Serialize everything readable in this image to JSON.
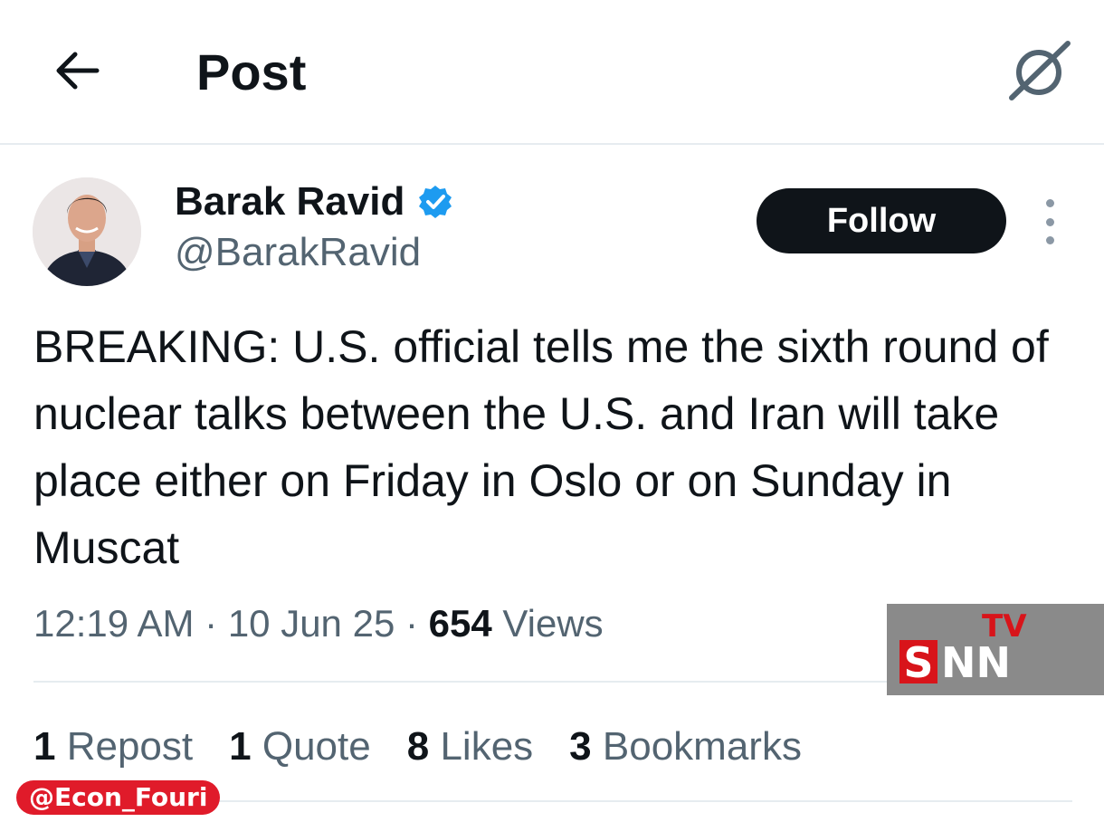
{
  "header": {
    "title": "Post",
    "back_icon": "arrow-left-icon",
    "grok_icon": "grok-icon"
  },
  "author": {
    "display_name": "Barak Ravid",
    "handle": "@BarakRavid",
    "verified_icon": "verified-badge-icon",
    "verified_color": "#1d9bf0"
  },
  "follow_button": {
    "label": "Follow"
  },
  "more_icon": "more-vertical-icon",
  "tweet": {
    "text": "BREAKING: U.S. official tells me the sixth round of nuclear talks between the U.S. and Iran will take place either on Friday in Oslo or on Sunday in Muscat",
    "time": "12:19 AM",
    "date": "10 Jun 25",
    "views_count": "654",
    "views_label": "Views",
    "separator": "·"
  },
  "stats": [
    {
      "count": "1",
      "label": "Repost"
    },
    {
      "count": "1",
      "label": "Quote"
    },
    {
      "count": "8",
      "label": "Likes"
    },
    {
      "count": "3",
      "label": "Bookmarks"
    }
  ],
  "watermark": {
    "s": "S",
    "nn": "NN",
    "tv": "TV"
  },
  "source_tag": "@Econ_Fouri",
  "colors": {
    "text_primary": "#0f1419",
    "text_secondary": "#536471",
    "follow_bg": "#0f1419",
    "tag_red": "#e01b2a"
  }
}
